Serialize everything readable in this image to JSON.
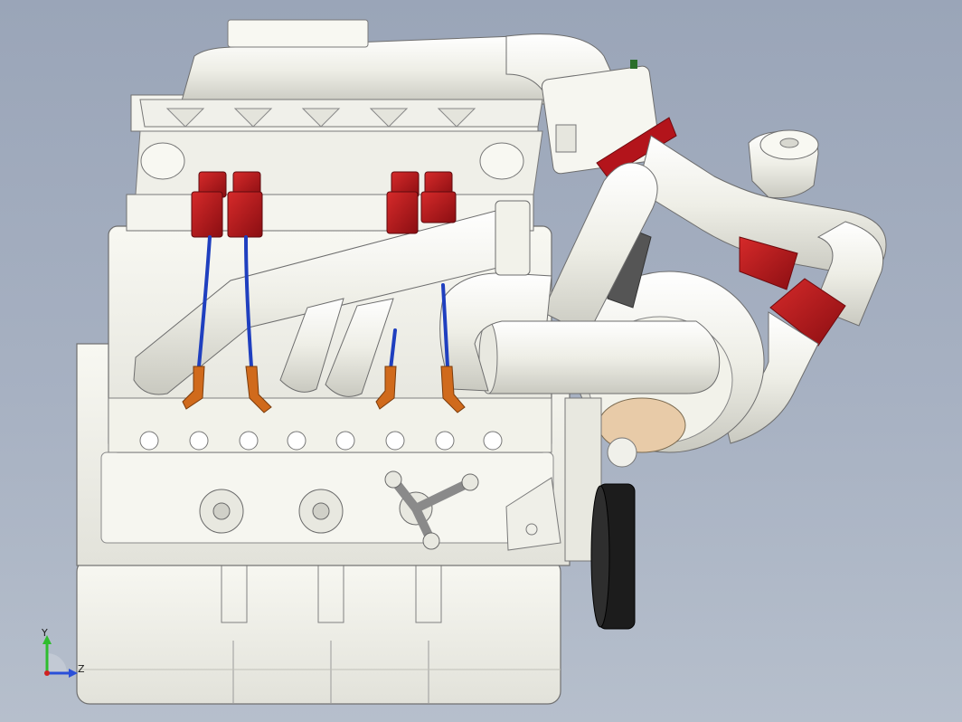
{
  "viewport": {
    "background_top": "#9aa5b8",
    "background_bottom": "#b6bfcc"
  },
  "model": {
    "part_color": "#f4f4ee",
    "edge_color": "#6e6e6e",
    "coil_color": "#b3141b",
    "wire_color": "#1f3fbf",
    "boot_color": "#d06a1c",
    "pulley_color": "#1c1c1c"
  },
  "triad": {
    "y_label": "Y",
    "z_label": "Z",
    "y_color": "#2ebd2e",
    "z_color": "#2a4fd8",
    "x_color": "#d02020"
  }
}
